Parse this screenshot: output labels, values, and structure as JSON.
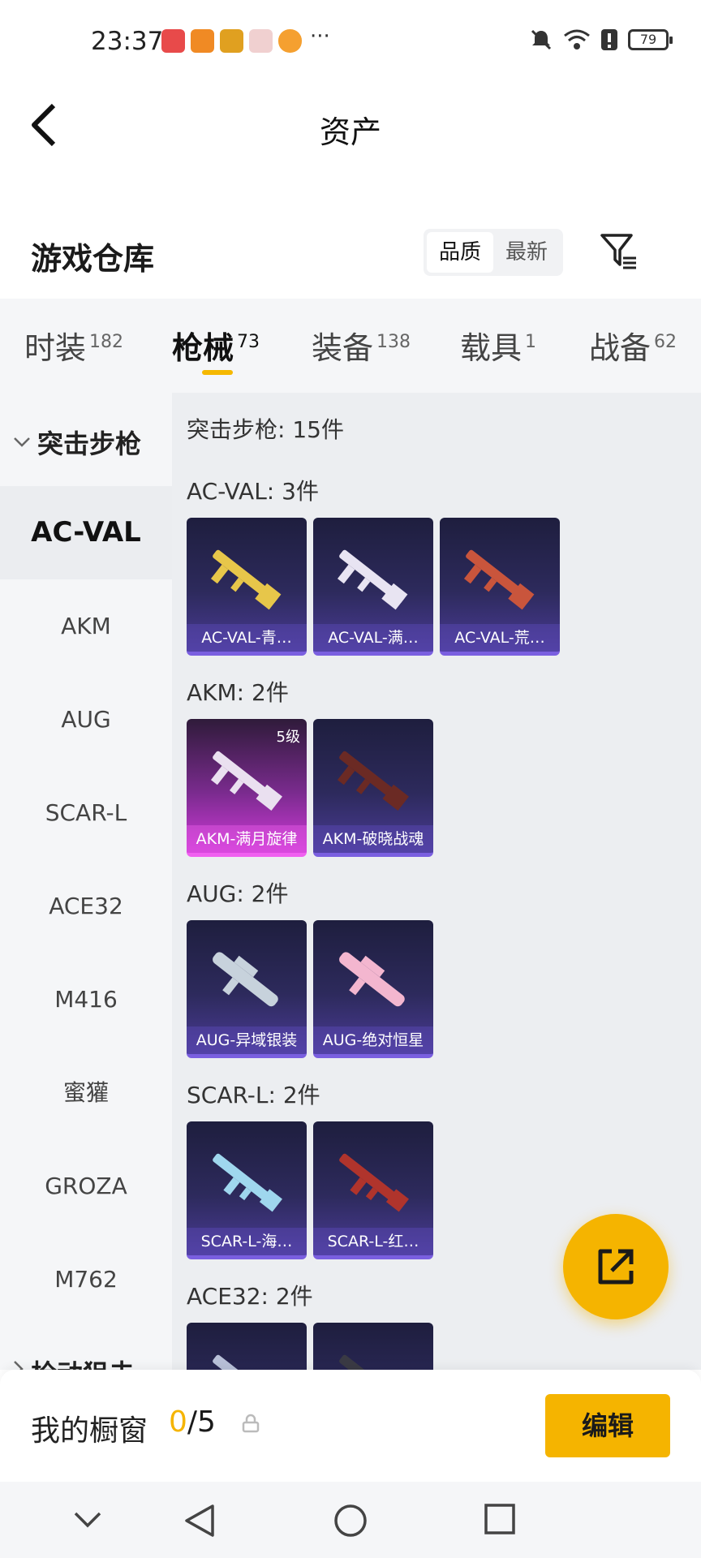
{
  "status_bar": {
    "time": "23:37",
    "more": "···",
    "battery": "79"
  },
  "header": {
    "title": "资产"
  },
  "warehouse": {
    "title": "游戏仓库",
    "sort_options": [
      "品质",
      "最新"
    ],
    "active_sort": "品质"
  },
  "tabs": [
    {
      "label": "时装",
      "count": "182"
    },
    {
      "label": "枪械",
      "count": "73",
      "active": true
    },
    {
      "label": "装备",
      "count": "138"
    },
    {
      "label": "载具",
      "count": "1"
    },
    {
      "label": "战备",
      "count": "62"
    }
  ],
  "left_nav": {
    "group": "突击步枪",
    "items": [
      "AC-VAL",
      "AKM",
      "AUG",
      "SCAR-L",
      "ACE32",
      "M416",
      "蜜獾",
      "GROZA",
      "M762"
    ],
    "active": "AC-VAL",
    "next_group": "栓动狙击"
  },
  "content": {
    "summary": "突击步枪: 15件",
    "sections": [
      {
        "title": "AC-VAL: 3件",
        "items": [
          {
            "name": "AC-VAL-青…",
            "color": "#e7c64a"
          },
          {
            "name": "AC-VAL-满…",
            "color": "#e8e4f2"
          },
          {
            "name": "AC-VAL-荒…",
            "color": "#c9553c"
          }
        ]
      },
      {
        "title": "AKM: 2件",
        "items": [
          {
            "name": "AKM-满月旋律",
            "color": "#eae0f0",
            "level": "5级",
            "rarity": "pink"
          },
          {
            "name": "AKM-破晓战魂",
            "color": "#6b2a24"
          }
        ]
      },
      {
        "title": "AUG: 2件",
        "items": [
          {
            "name": "AUG-异域银装",
            "color": "#c7d2dc"
          },
          {
            "name": "AUG-绝对恒星",
            "color": "#f3b6cf"
          }
        ]
      },
      {
        "title": "SCAR-L: 2件",
        "items": [
          {
            "name": "SCAR-L-海…",
            "color": "#9fd7ee"
          },
          {
            "name": "SCAR-L-红…",
            "color": "#b0342c"
          }
        ]
      },
      {
        "title": "ACE32: 2件",
        "items": [
          {
            "name": "",
            "color": "#b8c0d8"
          },
          {
            "name": "",
            "color": "#3a3a44"
          }
        ]
      }
    ]
  },
  "bottom": {
    "label": "我的橱窗",
    "current": "0",
    "total": "/5",
    "edit": "编辑"
  }
}
